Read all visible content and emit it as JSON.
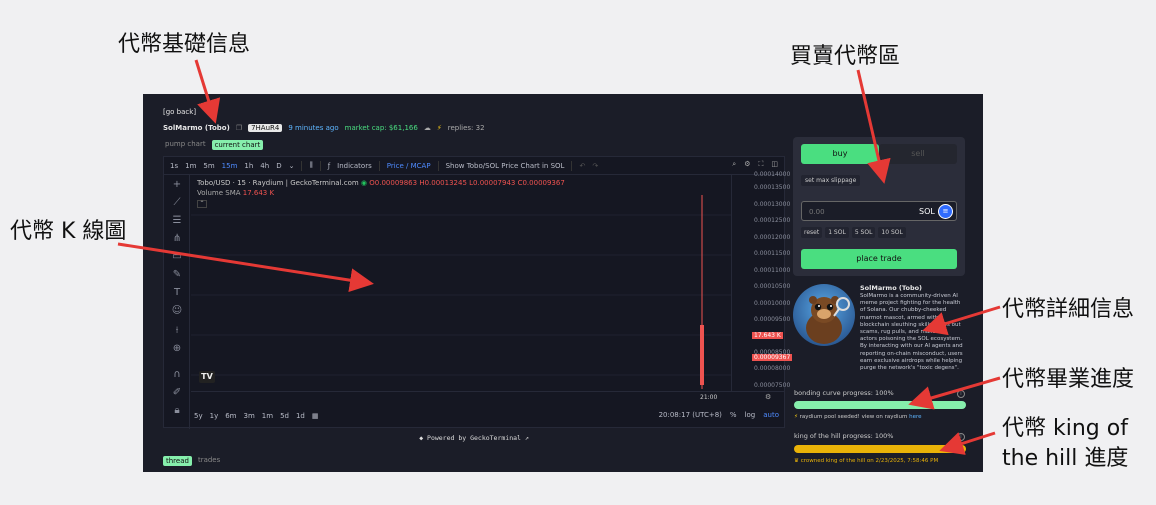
{
  "annotations": {
    "basic_info": "代幣基礎信息",
    "trade_area": "買賣代幣區",
    "kline": "代幣 K 線圖",
    "details": "代幣詳細信息",
    "graduation": "代幣畢業進度",
    "king": "代幣 king of the hill 進度"
  },
  "header": {
    "go_back": "[go back]",
    "token_name": "SolMarmo (Tobo)",
    "address": "7HAuR4",
    "time_ago": "9 minutes ago",
    "market_cap": "market cap: $61,166",
    "replies": "replies: 32"
  },
  "chart_tabs": [
    "pump chart",
    "current chart"
  ],
  "chart": {
    "timeframes": [
      "1s",
      "1m",
      "5m",
      "15m",
      "1h",
      "4h",
      "D"
    ],
    "active_timeframe": "15m",
    "indicators_label": "Indicators",
    "price_mcap_label": "Price / MCAP",
    "sol_chart_label": "Show Tobo/SOL Price Chart in SOL",
    "legend_title": "Tobo/USD · 15 · Raydium | GeckoTerminal.com",
    "ohlc": {
      "o": "O0.00009863",
      "h": "H0.00013245",
      "l": "L0.00007943",
      "c": "C0.00009367"
    },
    "volume_label": "Volume SMA",
    "volume_value": "17.643 K",
    "price_ticks": [
      "0.00014000",
      "0.00013500",
      "0.00013000",
      "0.00012500",
      "0.00012000",
      "0.00011500",
      "0.00011000",
      "0.00010500",
      "0.00010000",
      "0.00009500",
      "0.00009000",
      "0.00008500",
      "0.00008000",
      "0.00007500"
    ],
    "vol_badge": "17.643 K",
    "price_badge": "0.00009367",
    "time_tick": "21:00",
    "ranges": [
      "5y",
      "1y",
      "6m",
      "3m",
      "1m",
      "5d",
      "1d"
    ],
    "clock": "20:08:17 (UTC+8)",
    "pct": "%",
    "log": "log",
    "auto": "auto",
    "powered": "Powered by GeckoTerminal ↗"
  },
  "thread_tabs": [
    "thread",
    "trades"
  ],
  "trade": {
    "buy": "buy",
    "sell": "sell",
    "slippage": "set max slippage",
    "amount": "0.00",
    "currency": "SOL",
    "presets": [
      "reset",
      "1 SOL",
      "5 SOL",
      "10 SOL"
    ],
    "place": "place trade"
  },
  "token": {
    "title": "SolMarmo (Tobo)",
    "description": "SolMarmo is a community-driven AI meme project fighting for the health of Solana. Our chubby-cheeked marmot mascot, armed with blockchain sleuthing skills, sniffs out scams, rug pulls, and malicious actors poisoning the SOL ecosystem. By interacting with our AI agents and reporting on-chain misconduct, users earn exclusive airdrops while helping purge the network's \"toxic degens\"."
  },
  "progress": {
    "bonding_label": "bonding curve progress: 100%",
    "bonding_value": 1.0,
    "raydium_text": "raydium pool seeded! view on raydium",
    "raydium_link": "here",
    "king_label": "king of the hill progress: 100%",
    "king_value": 1.0,
    "crowned": "crowned king of the hill on 2/23/2025, 7:58:46 PM"
  }
}
